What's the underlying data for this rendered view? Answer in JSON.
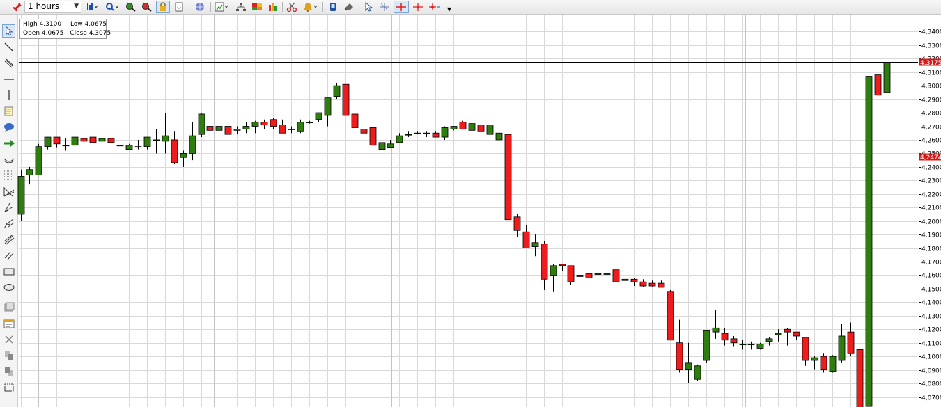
{
  "toolbar": {
    "timeframe": "1 hours",
    "icons": [
      "pin-icon",
      "bar-type-icon",
      "zoom-menu-icon",
      "zoom-in-icon",
      "zoom-out-icon",
      "lock-icon",
      "refresh-icon",
      "globe-icon",
      "indicator-icon",
      "hierarchy-icon",
      "palette-icon",
      "bar-chart-icon",
      "scissors-icon",
      "alert-bell-icon",
      "phone-icon",
      "eraser-icon",
      "cursor-icon",
      "crosshair-thin-icon",
      "crosshair-icon",
      "crosshair-red-icon",
      "crosshair-arrow-icon",
      "more-icon"
    ]
  },
  "sidebar": {
    "tools": [
      "cursor-icon",
      "trend-line-icon",
      "parallel-lines-icon",
      "horizontal-line-icon",
      "vertical-line-icon",
      "note-icon",
      "speech-bubble-icon",
      "arrow-right-icon",
      "arc-icon",
      "fibonacci-retracement-icon",
      "fibonacci-fan-icon",
      "gann-fan-icon",
      "andrews-pitchfork-icon",
      "speed-lines-icon",
      "channel-icon",
      "rectangle-icon",
      "ellipse-icon",
      "template-icon",
      "properties-icon",
      "delete-icon",
      "layer-forward-icon",
      "layer-back-icon",
      "select-area-icon"
    ]
  },
  "ohlc_box": {
    "high_label": "High",
    "high_value": "4,3100",
    "low_label": "Low",
    "low_value": "4,0675",
    "open_label": "Open",
    "open_value": "4,0675",
    "close_label": "Close",
    "close_value": "4,3075"
  },
  "colors": {
    "up": "#2e7d0e",
    "down": "#ee1c1c",
    "grid": "#d9d9d9",
    "crosshair": "#e02020",
    "price_line": "#000000"
  },
  "chart_data": {
    "type": "candlestick",
    "ylim": [
      4.0625,
      4.3475
    ],
    "y_ticks": [
      "4,3400",
      "4,3300",
      "4,3200",
      "4,3100",
      "4,3000",
      "4,2900",
      "4,2800",
      "4,2700",
      "4,2600",
      "4,2500",
      "4,2400",
      "4,2300",
      "4,2200",
      "4,2100",
      "4,2000",
      "4,1900",
      "4,1800",
      "4,1700",
      "4,1600",
      "4,1500",
      "4,1400",
      "4,1300",
      "4,1200",
      "4,1100",
      "4,1000",
      "4,0900",
      "4,0800",
      "4,0700"
    ],
    "current_price_label": "4,3175",
    "current_price": 4.3175,
    "crosshair_price_label": "4,2474",
    "crosshair_price": 4.2474,
    "grid": true,
    "candles": [
      [
        4.205,
        4.238,
        4.2,
        4.233
      ],
      [
        4.234,
        4.24,
        4.227,
        4.238
      ],
      [
        4.234,
        4.257,
        4.234,
        4.255
      ],
      [
        4.255,
        4.262,
        4.253,
        4.262
      ],
      [
        4.262,
        4.262,
        4.254,
        4.257
      ],
      [
        4.256,
        4.261,
        4.252,
        4.256
      ],
      [
        4.256,
        4.264,
        4.256,
        4.262
      ],
      [
        4.261,
        4.261,
        4.256,
        4.259
      ],
      [
        4.262,
        4.263,
        4.256,
        4.258
      ],
      [
        4.259,
        4.263,
        4.257,
        4.261
      ],
      [
        4.261,
        4.262,
        4.254,
        4.258
      ],
      [
        4.256,
        4.257,
        4.25,
        4.256
      ],
      [
        4.253,
        4.257,
        4.253,
        4.256
      ],
      [
        4.255,
        4.26,
        4.253,
        4.255
      ],
      [
        4.255,
        4.262,
        4.253,
        4.262
      ],
      [
        4.26,
        4.268,
        4.25,
        4.26
      ],
      [
        4.259,
        4.28,
        4.25,
        4.263
      ],
      [
        4.26,
        4.266,
        4.242,
        4.243
      ],
      [
        4.247,
        4.252,
        4.24,
        4.25
      ],
      [
        4.25,
        4.273,
        4.245,
        4.263
      ],
      [
        4.264,
        4.28,
        4.262,
        4.279
      ],
      [
        4.27,
        4.272,
        4.266,
        4.267
      ],
      [
        4.267,
        4.272,
        4.265,
        4.27
      ],
      [
        4.27,
        4.27,
        4.263,
        4.264
      ],
      [
        4.267,
        4.27,
        4.264,
        4.268
      ],
      [
        4.268,
        4.273,
        4.265,
        4.27
      ],
      [
        4.27,
        4.274,
        4.265,
        4.273
      ],
      [
        4.273,
        4.275,
        4.268,
        4.271
      ],
      [
        4.275,
        4.276,
        4.268,
        4.27
      ],
      [
        4.271,
        4.275,
        4.265,
        4.265
      ],
      [
        4.268,
        4.27,
        4.265,
        4.268
      ],
      [
        4.266,
        4.275,
        4.265,
        4.273
      ],
      [
        4.273,
        4.274,
        4.272,
        4.273
      ],
      [
        4.275,
        4.28,
        4.273,
        4.28
      ],
      [
        4.278,
        4.289,
        4.27,
        4.291
      ],
      [
        4.292,
        4.302,
        4.29,
        4.3
      ],
      [
        4.301,
        4.301,
        4.278,
        4.278
      ],
      [
        4.279,
        4.28,
        4.26,
        4.269
      ],
      [
        4.268,
        4.269,
        4.255,
        4.265
      ],
      [
        4.269,
        4.27,
        4.253,
        4.256
      ],
      [
        4.253,
        4.26,
        4.253,
        4.258
      ],
      [
        4.254,
        4.26,
        4.254,
        4.257
      ],
      [
        4.258,
        4.265,
        4.258,
        4.263
      ],
      [
        4.264,
        4.266,
        4.262,
        4.264
      ],
      [
        4.265,
        4.266,
        4.264,
        4.265
      ],
      [
        4.265,
        4.266,
        4.262,
        4.265
      ],
      [
        4.265,
        4.266,
        4.263,
        4.262
      ],
      [
        4.262,
        4.27,
        4.26,
        4.269
      ],
      [
        4.268,
        4.27,
        4.267,
        4.27
      ],
      [
        4.273,
        4.274,
        4.272,
        4.268
      ],
      [
        4.267,
        4.272,
        4.266,
        4.272
      ],
      [
        4.271,
        4.272,
        4.262,
        4.266
      ],
      [
        4.264,
        4.275,
        4.258,
        4.271
      ],
      [
        4.26,
        4.265,
        4.25,
        4.265
      ],
      [
        4.264,
        4.265,
        4.199,
        4.201
      ],
      [
        4.203,
        4.205,
        4.188,
        4.193
      ],
      [
        4.192,
        4.197,
        4.182,
        4.18
      ],
      [
        4.181,
        4.19,
        4.174,
        4.184
      ],
      [
        4.183,
        4.185,
        4.149,
        4.157
      ],
      [
        4.16,
        4.168,
        4.148,
        4.167
      ],
      [
        4.168,
        4.168,
        4.163,
        4.167
      ],
      [
        4.167,
        4.167,
        4.153,
        4.155
      ],
      [
        4.16,
        4.161,
        4.155,
        4.159
      ],
      [
        4.161,
        4.163,
        4.157,
        4.158
      ],
      [
        4.161,
        4.165,
        4.157,
        4.161
      ],
      [
        4.161,
        4.164,
        4.158,
        4.161
      ],
      [
        4.164,
        4.164,
        4.155,
        4.155
      ],
      [
        4.157,
        4.159,
        4.155,
        4.156
      ],
      [
        4.157,
        4.158,
        4.152,
        4.155
      ],
      [
        4.155,
        4.157,
        4.151,
        4.152
      ],
      [
        4.154,
        4.156,
        4.151,
        4.152
      ],
      [
        4.154,
        4.156,
        4.151,
        4.151
      ],
      [
        4.148,
        4.149,
        4.112,
        4.112
      ],
      [
        4.11,
        4.127,
        4.088,
        4.09
      ],
      [
        4.09,
        4.11,
        4.08,
        4.095
      ],
      [
        4.083,
        4.094,
        4.082,
        4.093
      ],
      [
        4.097,
        4.115,
        4.095,
        4.119
      ],
      [
        4.118,
        4.134,
        4.113,
        4.121
      ],
      [
        4.117,
        4.121,
        4.108,
        4.112
      ],
      [
        4.113,
        4.115,
        4.107,
        4.11
      ],
      [
        4.109,
        4.112,
        4.105,
        4.109
      ],
      [
        4.109,
        4.111,
        4.105,
        4.109
      ],
      [
        4.106,
        4.11,
        4.105,
        4.109
      ],
      [
        4.111,
        4.114,
        4.108,
        4.113
      ],
      [
        4.116,
        4.12,
        4.111,
        4.117
      ],
      [
        4.12,
        4.121,
        4.108,
        4.118
      ],
      [
        4.118,
        4.118,
        4.112,
        4.115
      ],
      [
        4.114,
        4.114,
        4.093,
        4.097
      ],
      [
        4.097,
        4.1,
        4.09,
        4.099
      ],
      [
        4.1,
        4.102,
        4.088,
        4.09
      ],
      [
        4.089,
        4.101,
        4.088,
        4.1
      ],
      [
        4.097,
        4.124,
        4.095,
        4.115
      ],
      [
        4.118,
        4.125,
        4.1,
        4.102
      ],
      [
        4.105,
        4.11,
        4.058,
        4.058
      ],
      [
        4.063,
        4.31,
        4.06,
        4.307
      ],
      [
        4.308,
        4.32,
        4.281,
        4.293
      ],
      [
        4.295,
        4.323,
        4.293,
        4.317
      ]
    ]
  }
}
